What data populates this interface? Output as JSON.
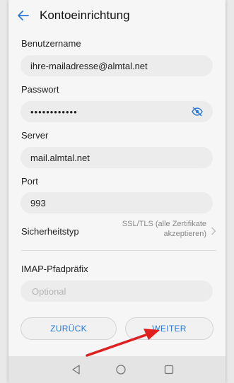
{
  "header": {
    "title": "Kontoeinrichtung",
    "back_icon": "back-arrow-icon"
  },
  "form": {
    "username": {
      "label": "Benutzername",
      "value": "ihre-mailadresse@almtal.net"
    },
    "password": {
      "label": "Passwort",
      "value": "••••••••••••",
      "toggle_icon": "eye-hidden-icon"
    },
    "server": {
      "label": "Server",
      "value": "mail.almtal.net"
    },
    "port": {
      "label": "Port",
      "value": "993"
    },
    "security": {
      "label": "Sicherheitstyp",
      "value": "SSL/TLS (alle Zertifikate akzeptieren)"
    },
    "imap_prefix": {
      "label": "IMAP-Pfadpräfix",
      "placeholder": "Optional"
    }
  },
  "buttons": {
    "back_label": "ZURÜCK",
    "next_label": "WEITER"
  },
  "colors": {
    "accent": "#2c7ad6",
    "arrow": "#e0201f"
  },
  "navbar": {
    "icons": [
      "back-triangle-icon",
      "home-circle-icon",
      "recents-square-icon"
    ]
  }
}
